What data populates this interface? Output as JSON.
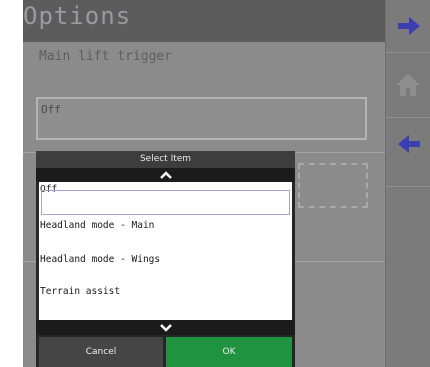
{
  "title": "Options",
  "sections": [
    {
      "label": "Main lift trigger",
      "value": "Off"
    }
  ],
  "dialog": {
    "header": "Select Item",
    "items": [
      {
        "label": "Off",
        "selected": true
      },
      {
        "label": "Headland mode - Main",
        "selected": false
      },
      {
        "label": "Headland mode - Wings",
        "selected": false
      },
      {
        "label": "Terrain assist",
        "selected": false
      }
    ],
    "cancel_label": "Cancel",
    "ok_label": "OK"
  },
  "rightbar": {
    "buttons": [
      "next-arrow-icon",
      "home-icon",
      "back-arrow-icon"
    ]
  },
  "colors": {
    "accent_arrow": "#3b3fb0",
    "ok_green": "#209340",
    "selection_border": "#a7a3d6"
  }
}
